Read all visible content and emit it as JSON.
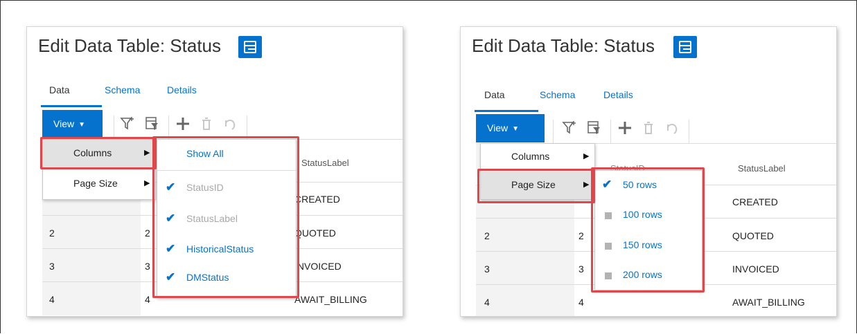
{
  "panels": [
    {
      "title": "Edit Data Table: Status",
      "tabs": [
        "Data",
        "Schema",
        "Details"
      ],
      "view_label": "View",
      "header": {
        "col3": "StatusLabel"
      },
      "rows": [
        {
          "idx": "2",
          "id": "2",
          "label": "QUOTED"
        },
        {
          "idx": "3",
          "id": "3",
          "label": "INVOICED"
        },
        {
          "idx": "4",
          "id": "4",
          "label": "AWAIT_BILLING"
        }
      ],
      "row1_label": "CREATED",
      "view_menu": [
        "Columns",
        "Page Size"
      ],
      "columns_submenu": {
        "show_all": "Show All",
        "items": [
          {
            "label": "StatusID",
            "checked": true,
            "enabled": false
          },
          {
            "label": "StatusLabel",
            "checked": true,
            "enabled": false
          },
          {
            "label": "HistoricalStatus",
            "checked": true,
            "enabled": true
          },
          {
            "label": "DMStatus",
            "checked": true,
            "enabled": true
          }
        ]
      }
    },
    {
      "title": "Edit Data Table: Status",
      "tabs": [
        "Data",
        "Schema",
        "Details"
      ],
      "view_label": "View",
      "header": {
        "col2": "StatusID",
        "col3": "StatusLabel"
      },
      "row1_label": "CREATED",
      "rows": [
        {
          "idx": "2",
          "id": "2",
          "label": "QUOTED"
        },
        {
          "idx": "3",
          "id": "3",
          "label": "INVOICED"
        },
        {
          "idx": "4",
          "id": "4",
          "label": "AWAIT_BILLING"
        }
      ],
      "view_menu": [
        "Columns",
        "Page Size"
      ],
      "pagesize_submenu": [
        {
          "label": "50 rows",
          "selected": true
        },
        {
          "label": "100 rows",
          "selected": false
        },
        {
          "label": "150 rows",
          "selected": false
        },
        {
          "label": "200 rows",
          "selected": false
        }
      ]
    }
  ],
  "icons": {
    "table": "table-icon",
    "filter": "filter-icon",
    "filter_row": "filter-row-icon",
    "add": "plus-icon",
    "delete": "trash-icon",
    "undo": "undo-icon",
    "caret": "caret-down-icon",
    "submenu_arrow": "caret-right-icon",
    "check": "check-icon"
  },
  "colors": {
    "accent": "#0572ce",
    "highlight_border": "#e0474c",
    "menu_highlight": "#e2e2e2"
  }
}
